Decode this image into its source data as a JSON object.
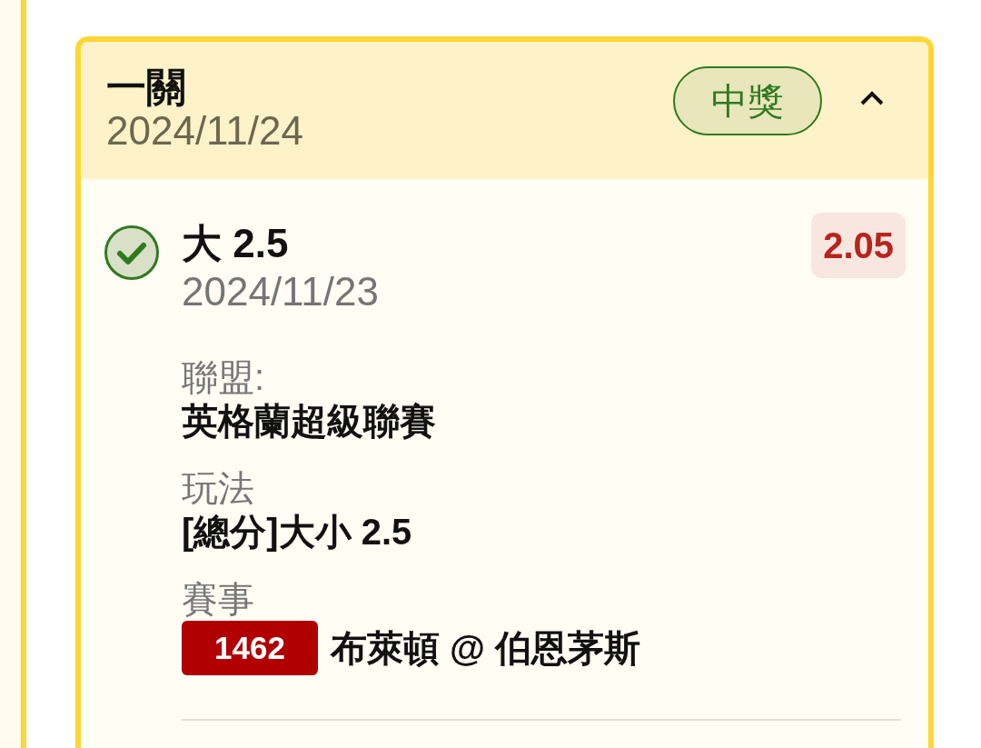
{
  "bet_card": {
    "title": "一關",
    "date": "2024/11/24",
    "status": "中獎",
    "expanded": true,
    "selections": [
      {
        "won": true,
        "pick": "大 2.5",
        "date": "2024/11/23",
        "odds": "2.05",
        "details": [
          {
            "label": "聯盟:",
            "value": "英格蘭超級聯賽"
          },
          {
            "label": "玩法",
            "value": "[總分]大小 2.5"
          }
        ],
        "match": {
          "label": "賽事",
          "code": "1462",
          "teams": "布萊頓 @ 伯恩茅斯"
        }
      }
    ]
  }
}
